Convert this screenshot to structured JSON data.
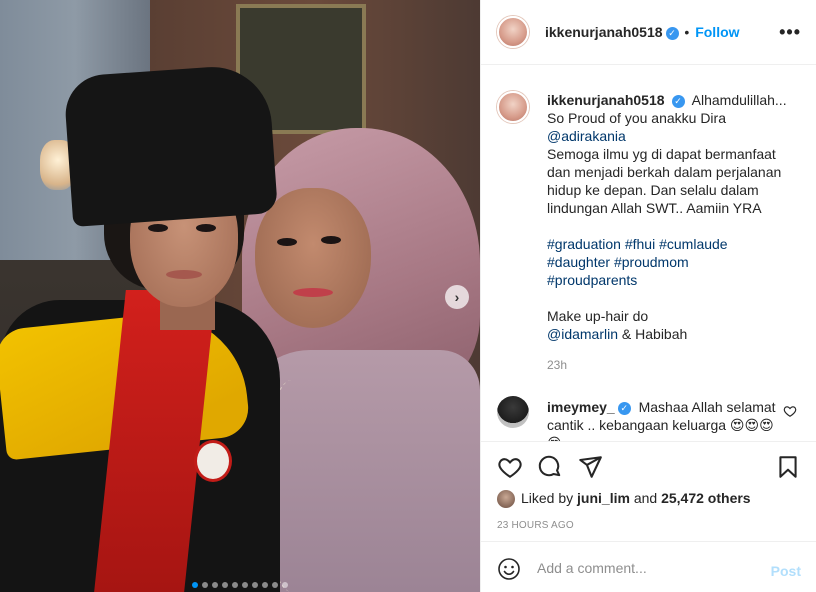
{
  "post": {
    "username": "ikkenurjanah0518",
    "follow_label": "Follow",
    "separator": "•",
    "more_icon": "more-horizontal-icon"
  },
  "caption": {
    "username": "ikkenurjanah0518",
    "line1": "Alhamdulillah...",
    "line2": "So Proud of you anakku Dira",
    "mention1": "@adirakania",
    "body": "Semoga ilmu yg di dapat bermanfaat dan menjadi berkah dalam perjalanan hidup ke depan. Dan selalu dalam lindungan Allah SWT.. Aamiin YRA",
    "tags_line1": [
      "#graduation",
      "#fhui",
      "#cumlaude"
    ],
    "tags_line2": [
      "#daughter",
      "#proudmom"
    ],
    "tags_line3": [
      "#proudparents"
    ],
    "makeup_label": "Make up-hair do",
    "mention2": "@idamarlin",
    "makeup_rest": "& Habibah",
    "time_ago": "23h"
  },
  "comment": {
    "username": "imeymey_",
    "text": "Mashaa Allah selamat cantik .. kebangaan keluarga 😍😍😍😍"
  },
  "likes": {
    "prefix": "Liked by",
    "user": "juni_lim",
    "connector": "and",
    "count": "25,472 others"
  },
  "timestamp": "23 HOURS AGO",
  "add_comment": {
    "placeholder": "Add a comment...",
    "post_label": "Post"
  },
  "carousel": {
    "dots_total": 10,
    "active_index": 0
  },
  "colors": {
    "accent": "#0095f6",
    "link": "#00376b",
    "muted": "#8e8e8e",
    "verified": "#3897f0"
  }
}
